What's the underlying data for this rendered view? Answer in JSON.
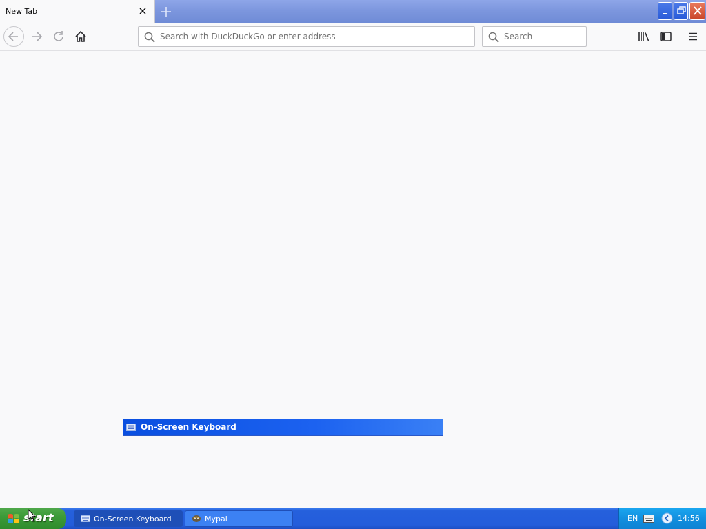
{
  "browser": {
    "tab": {
      "title": "New Tab"
    },
    "urlbar": {
      "placeholder": "Search with DuckDuckGo or enter address"
    },
    "searchbar": {
      "placeholder": "Search"
    }
  },
  "osk_window": {
    "title": "On-Screen Keyboard"
  },
  "taskbar": {
    "start_label": "start",
    "items": [
      {
        "label": "On-Screen Keyboard",
        "icon": "keyboard-icon"
      },
      {
        "label": "Mypal",
        "icon": "mypal-icon"
      }
    ],
    "tray": {
      "language": "EN",
      "clock": "14:56"
    }
  },
  "colors": {
    "taskbar": "#245ddb",
    "start": "#3c9a38",
    "osk_titlebar": "#0a4fe0",
    "page_bg": "#f9f9fa"
  }
}
